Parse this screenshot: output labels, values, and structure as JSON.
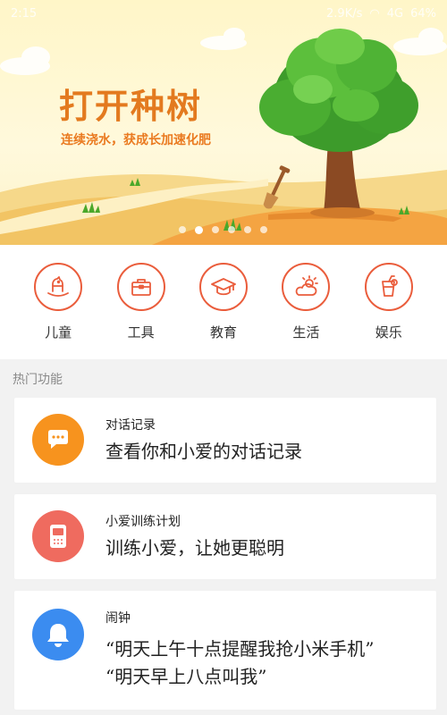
{
  "status_bar": {
    "time": "2:15",
    "speed": "2.9K/s",
    "signal": "4G",
    "battery": "64%"
  },
  "banner": {
    "title": "打开种树",
    "subtitle": "连续浇水，获成长加速化肥",
    "page_indicator": {
      "total": 6,
      "active": 2
    }
  },
  "categories": [
    {
      "label": "儿童",
      "icon": "rocking-horse-icon"
    },
    {
      "label": "工具",
      "icon": "toolbox-icon"
    },
    {
      "label": "教育",
      "icon": "graduation-cap-icon"
    },
    {
      "label": "生活",
      "icon": "sun-cloud-icon"
    },
    {
      "label": "娱乐",
      "icon": "drink-cup-icon"
    }
  ],
  "hot": {
    "title": "热门功能",
    "cards": [
      {
        "small": "对话记录",
        "big": "查看你和小爱的对话记录",
        "icon": "chat-bubble-icon",
        "color": "#f7931e"
      },
      {
        "small": "小爱训练计划",
        "big": "训练小爱，让她更聪明",
        "icon": "speaker-icon",
        "color": "#ef6b5f"
      },
      {
        "small": "闹钟",
        "big1": "“明天上午十点提醒我抢小米手机”",
        "big2": "“明天早上八点叫我”",
        "icon": "bell-icon",
        "color": "#3b8cf0"
      }
    ]
  },
  "colors": {
    "accent": "#ea5d3c",
    "banner_title": "#e37a1f"
  }
}
